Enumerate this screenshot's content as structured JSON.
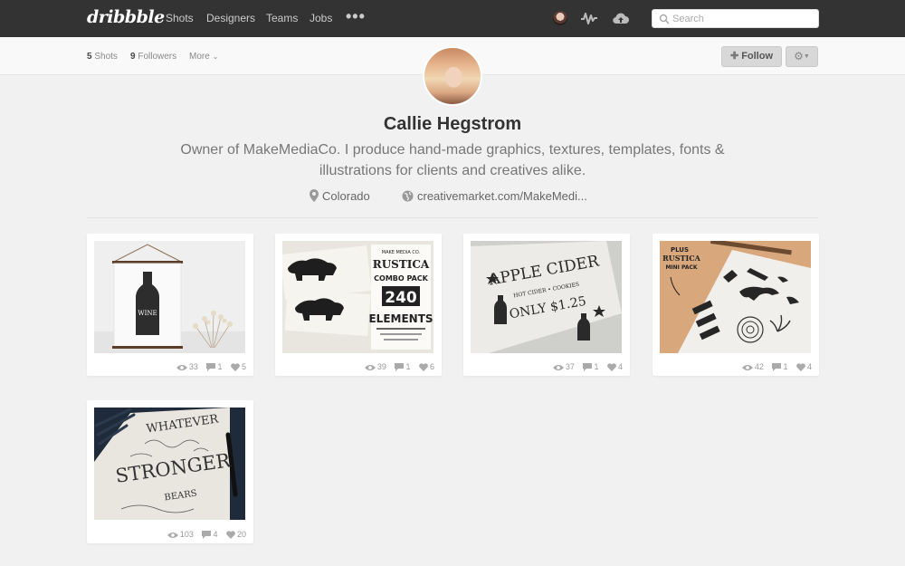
{
  "nav": {
    "logo": "dribbble",
    "links": [
      "Shots",
      "Designers",
      "Teams",
      "Jobs"
    ],
    "more": "•••",
    "search_placeholder": "Search"
  },
  "subbar": {
    "shots_count": "5",
    "shots_label": "Shots",
    "followers_count": "9",
    "followers_label": "Followers",
    "more_label": "More",
    "follow_label": "Follow"
  },
  "profile": {
    "name": "Callie Hegstrom",
    "bio": "Owner of MakeMediaCo. I produce hand-made graphics, textures, templates, fonts & illustrations for clients and creatives alike.",
    "location": "Colorado",
    "website": "creativemarket.com/MakeMedi..."
  },
  "shots": [
    {
      "views": "33",
      "comments": "1",
      "likes": "5",
      "art_text": [
        "WINE"
      ]
    },
    {
      "views": "39",
      "comments": "1",
      "likes": "6",
      "art_text": [
        "MAKE MEDIA CO.",
        "RUSTICA",
        "COMBO PACK",
        "240",
        "ELEMENTS"
      ]
    },
    {
      "views": "37",
      "comments": "1",
      "likes": "4",
      "art_text": [
        "APPLE CIDER",
        "HOT CIDER • COOKIES",
        "ONLY $1.25"
      ]
    },
    {
      "views": "42",
      "comments": "1",
      "likes": "4",
      "art_text": [
        "PLUS",
        "RUSTICA",
        "MINI PACK"
      ]
    },
    {
      "views": "103",
      "comments": "4",
      "likes": "20",
      "art_text": [
        "WHATEVER",
        "STRONGER",
        "BEARS"
      ]
    }
  ],
  "colors": {
    "topbar": "#333333",
    "page_bg": "#f1f1f1",
    "card_bg": "#ffffff"
  }
}
